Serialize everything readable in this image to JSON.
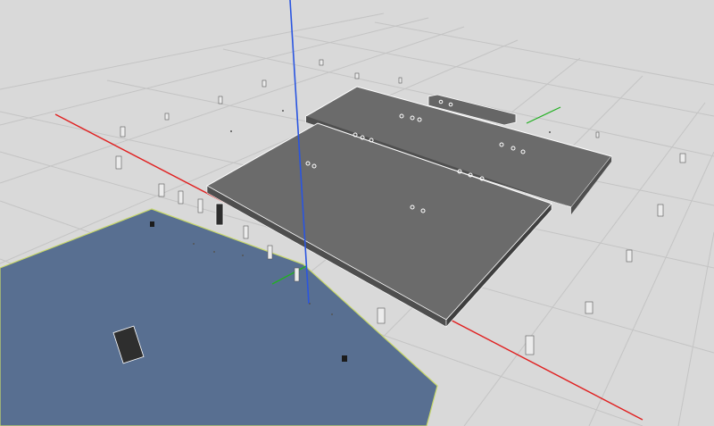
{
  "viewport": {
    "background_color": "#d9d9d9",
    "grid_color": "#c4c4c4",
    "axis_x_color": "#e02020",
    "axis_y_color": "#22b022",
    "axis_z_color": "#2a55e0",
    "ground_plane_color": "#586f91",
    "ground_plane_edge_color": "#c8d86a",
    "platform_top_color": "#6b6b6b",
    "platform_side_color": "#505050",
    "platform_edge_color": "#ffffff",
    "marker_color": "#ececec",
    "marker_dark_color": "#3a3a3a"
  }
}
